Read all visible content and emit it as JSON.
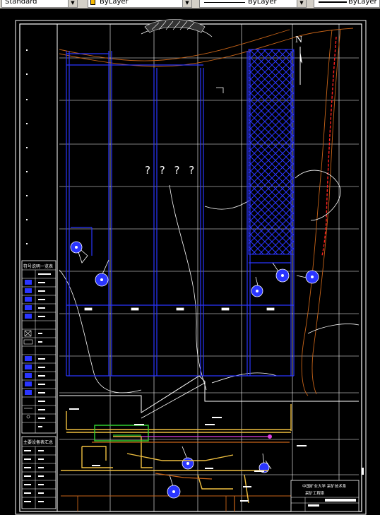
{
  "toolbar": {
    "text_style": "Standard",
    "layer_color": "ByLayer",
    "linetype": "ByLayer",
    "lineweight": "ByLayer"
  },
  "drawing": {
    "north_label": "N",
    "question_marks": "? ? ? ?",
    "legend1_title": "符号说明一览表",
    "legend2_title": "主要设备表汇总",
    "title_block_line1": "中国矿业大学 采矿技术系",
    "title_block_line2": "采矿工程系"
  },
  "colors": {
    "blue": "#2a35ff",
    "white": "#ffffff",
    "yellow": "#f0c040",
    "orange": "#c86418",
    "red": "#ff2020",
    "green": "#30d030",
    "magenta": "#e040e0"
  }
}
